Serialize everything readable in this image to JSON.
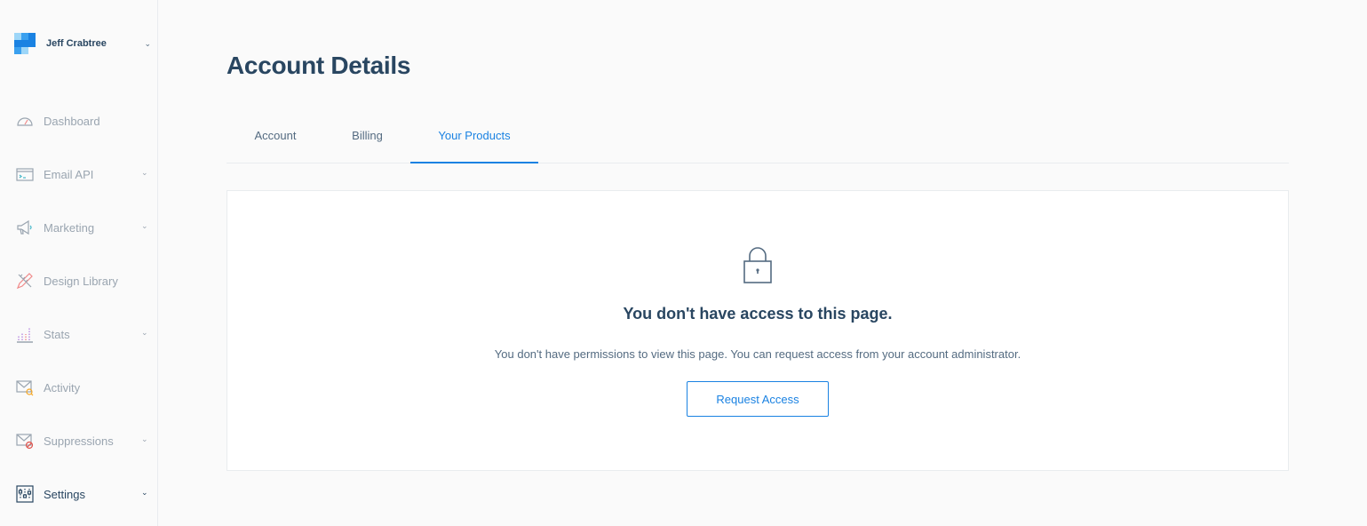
{
  "user": {
    "name": "Jeff Crabtree"
  },
  "sidebar": {
    "items": [
      {
        "label": "Dashboard",
        "icon": "dashboard-icon",
        "has_submenu": false
      },
      {
        "label": "Email API",
        "icon": "email-api-icon",
        "has_submenu": true
      },
      {
        "label": "Marketing",
        "icon": "megaphone-icon",
        "has_submenu": true
      },
      {
        "label": "Design Library",
        "icon": "design-library-icon",
        "has_submenu": false
      },
      {
        "label": "Stats",
        "icon": "stats-icon",
        "has_submenu": true
      },
      {
        "label": "Activity",
        "icon": "activity-icon",
        "has_submenu": false
      },
      {
        "label": "Suppressions",
        "icon": "suppressions-icon",
        "has_submenu": true
      },
      {
        "label": "Settings",
        "icon": "settings-icon",
        "has_submenu": true,
        "active": true
      }
    ]
  },
  "page": {
    "title": "Account Details"
  },
  "tabs": [
    {
      "label": "Account",
      "active": false
    },
    {
      "label": "Billing",
      "active": false
    },
    {
      "label": "Your Products",
      "active": true
    }
  ],
  "access": {
    "icon": "lock-icon",
    "heading": "You don't have access to this page.",
    "message": "You don't have permissions to view this page. You can request access from your account administrator.",
    "button_label": "Request Access"
  },
  "colors": {
    "accent": "#1a82e2",
    "heading": "#294661",
    "muted": "#9aa5b0",
    "background": "#fafafa"
  }
}
